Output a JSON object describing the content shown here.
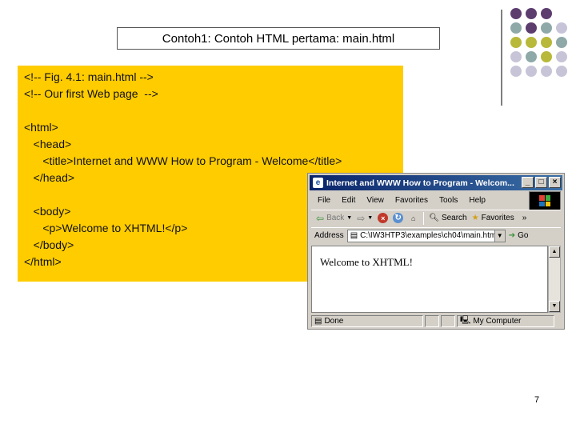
{
  "slide": {
    "title": "Contoh1: Contoh HTML pertama: main.html",
    "page_number": "7",
    "code_lines": [
      "<!-- Fig. 4.1: main.html -->",
      "<!-- Our first Web page  -->",
      "",
      "<html>",
      "   <head>",
      "      <title>Internet and WWW How to Program - Welcome</title>",
      "   </head>",
      "",
      "   <body>",
      "      <p>Welcome to XHTML!</p>",
      "   </body>",
      "</html>"
    ],
    "colors": {
      "code_bg": "#ffcc00",
      "dot_purple": "#5c3d6e",
      "dot_teal": "#8fa8a8",
      "dot_olive": "#b8b83a",
      "dot_lavender": "#c8c4d8"
    }
  },
  "browser": {
    "window_title": "Internet and WWW How to Program - Welcom...",
    "menu": [
      "File",
      "Edit",
      "View",
      "Favorites",
      "Tools",
      "Help"
    ],
    "toolbar": {
      "back": "Back",
      "search": "Search",
      "favorites": "Favorites",
      "more": "»"
    },
    "address_label": "Address",
    "address_value": "C:\\IW3HTP3\\examples\\ch04\\main.htm",
    "go_label": "Go",
    "content_text": "Welcome to XHTML!",
    "status_text": "Done",
    "zone_text": "My Computer"
  }
}
